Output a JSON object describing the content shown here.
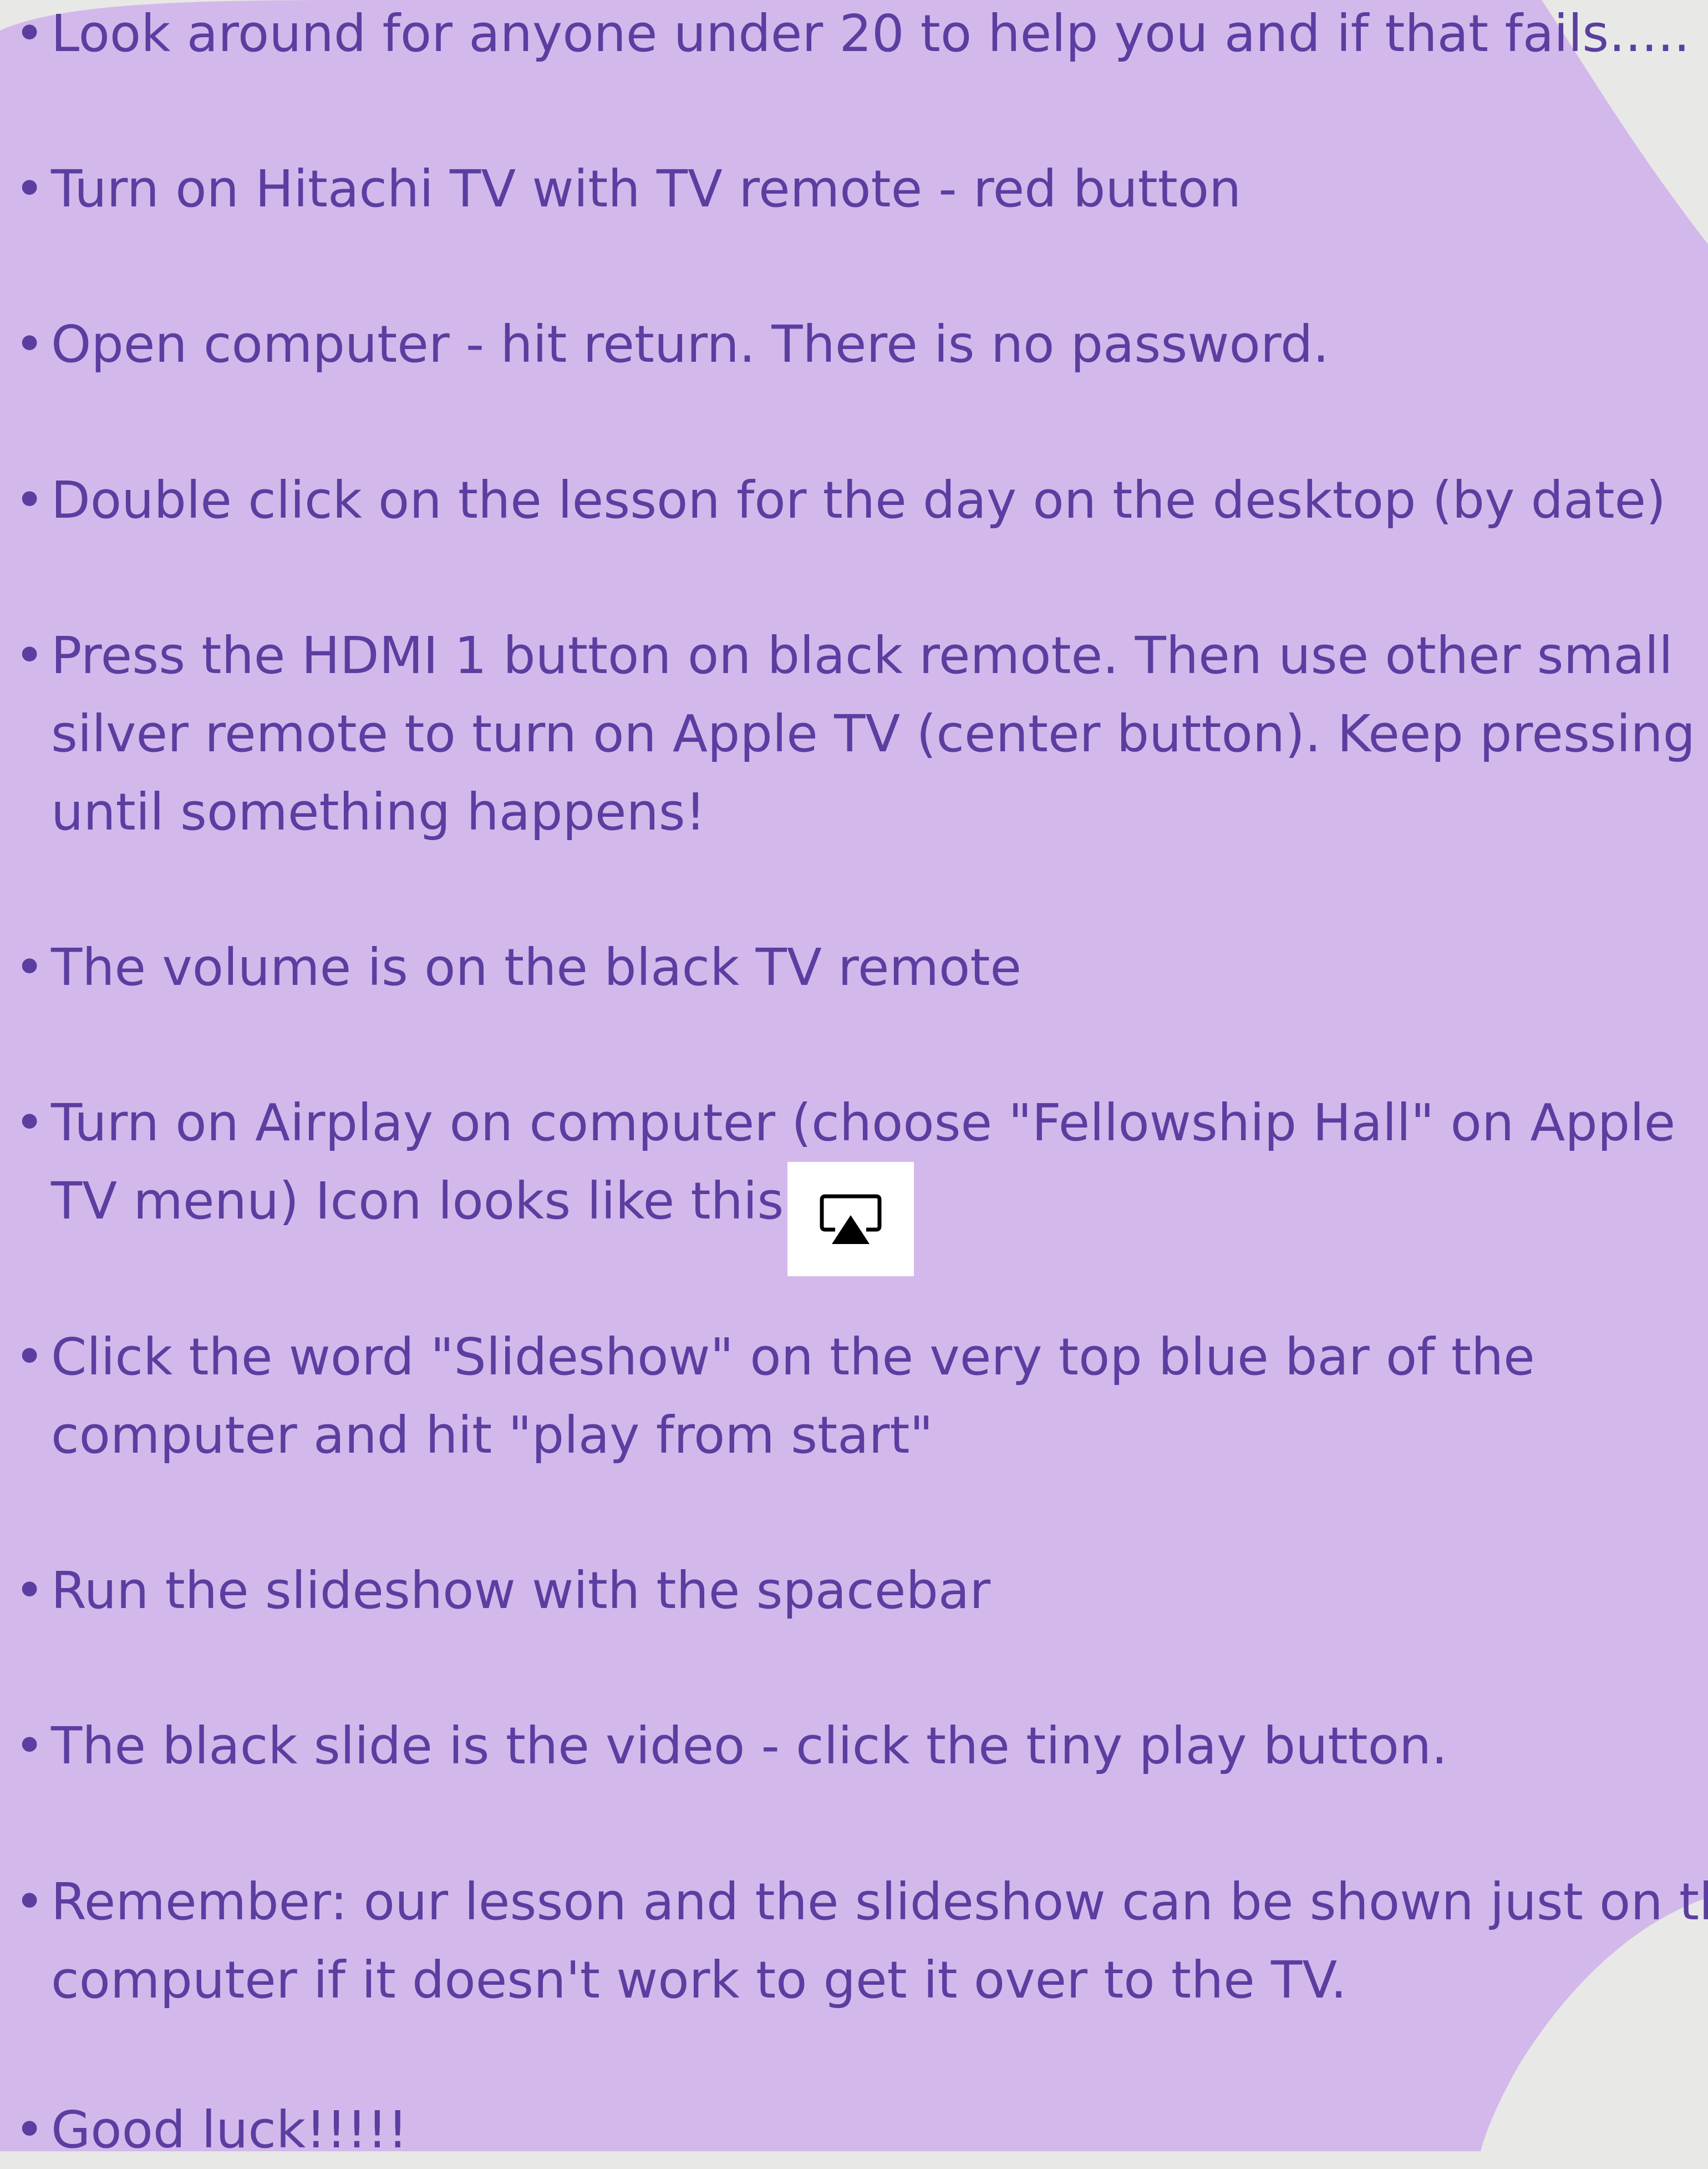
{
  "colors": {
    "background": "#e8e8e6",
    "blob": "#d3b8eb",
    "text": "#5b3ea0",
    "icon_box": "#ffffff",
    "icon": "#000000"
  },
  "bullet_char": "•",
  "items": [
    {
      "lines": [
        "Look around for anyone under 20 to help you and if that fails....."
      ]
    },
    {
      "lines": [
        "Turn on Hitachi TV with TV remote - red button"
      ]
    },
    {
      "lines": [
        "Open computer - hit return.  There is no password."
      ]
    },
    {
      "lines": [
        "Double click on the lesson for the day on the desktop (by date)"
      ]
    },
    {
      "lines": [
        "Press the HDMI 1 button on black remote.  Then use other small",
        "silver remote to turn on Apple TV (center button).  Keep pressing",
        "until something happens!"
      ]
    },
    {
      "lines": [
        "The volume is on the black TV remote"
      ]
    },
    {
      "lines": [
        " Turn on Airplay on computer (choose \"Fellowship Hall\" on Apple",
        "TV menu) Icon looks like this:"
      ]
    },
    {
      "lines": [
        "Click the word \"Slideshow\" on the very top blue bar of the",
        "computer and hit \"play from start\""
      ]
    },
    {
      "lines": [
        "Run the slideshow with the spacebar"
      ]
    },
    {
      "lines": [
        "The black slide is the video - click the tiny play button."
      ]
    },
    {
      "lines": [
        "Remember:  our lesson and the slideshow can be shown just on the",
        "computer if it doesn't work to get it over to the TV."
      ]
    },
    {
      "lines": [
        "Good luck!!!!!"
      ]
    }
  ],
  "airplay_icon": "airplay-icon"
}
